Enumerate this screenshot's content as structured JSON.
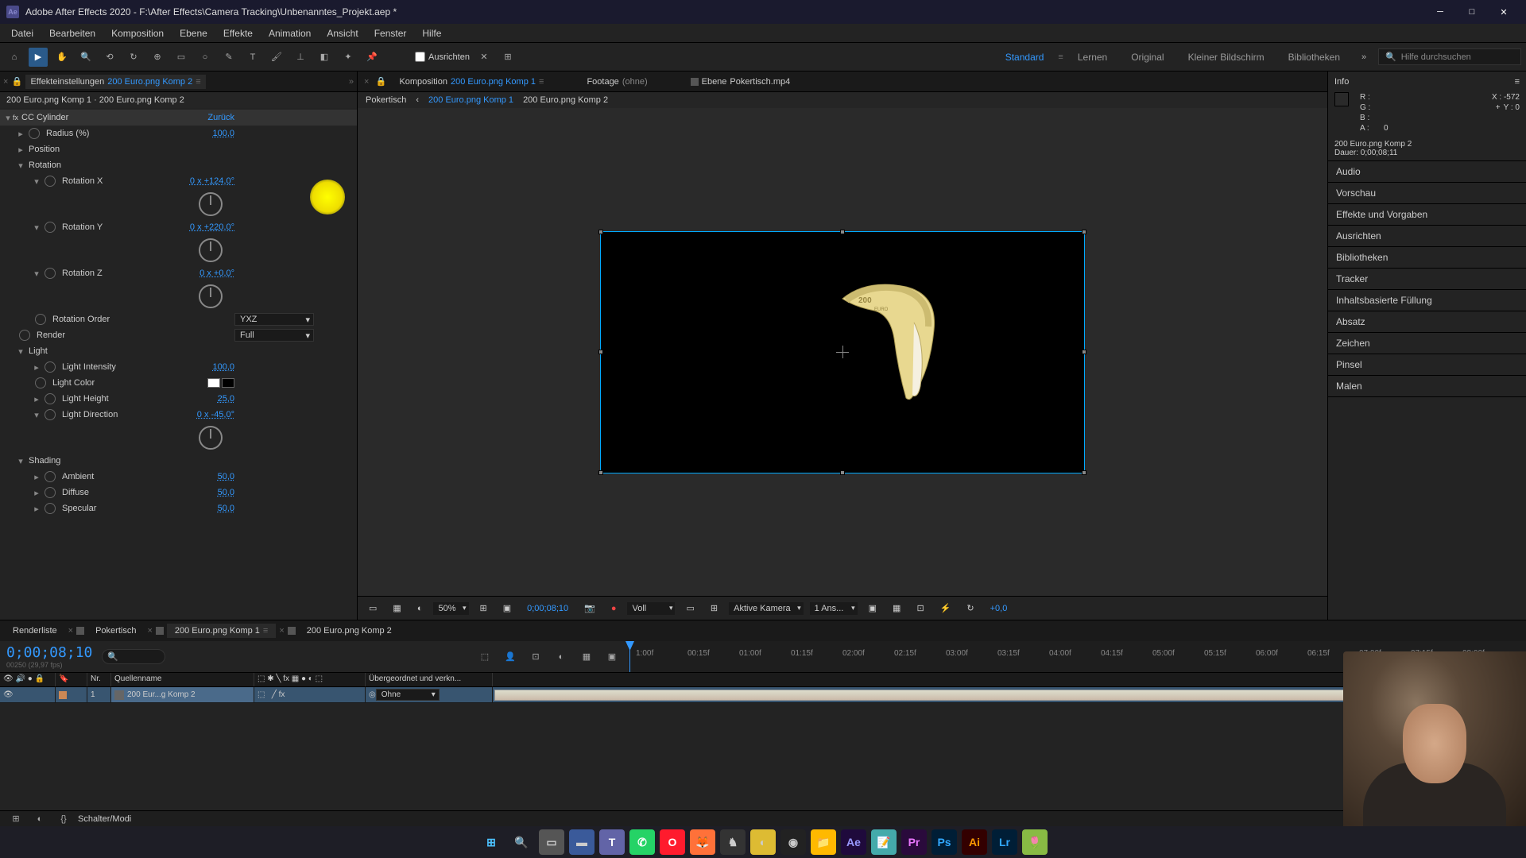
{
  "app": {
    "title": "Adobe After Effects 2020 - F:\\After Effects\\Camera Tracking\\Unbenanntes_Projekt.aep *"
  },
  "menu": {
    "items": [
      "Datei",
      "Bearbeiten",
      "Komposition",
      "Ebene",
      "Effekte",
      "Animation",
      "Ansicht",
      "Fenster",
      "Hilfe"
    ]
  },
  "toolbar": {
    "ausrichten": "Ausrichten",
    "workspaces": [
      "Standard",
      "Lernen",
      "Original",
      "Kleiner Bildschirm",
      "Bibliotheken"
    ],
    "active_workspace": "Standard",
    "search_placeholder": "Hilfe durchsuchen"
  },
  "effects_panel": {
    "tab_label": "Effekteinstellungen",
    "tab_comp": "200 Euro.png Komp 2",
    "breadcrumb": "200 Euro.png Komp 1 · 200 Euro.png Komp 2",
    "effect_name": "CC Cylinder",
    "reset": "Zurück",
    "props": {
      "radius": {
        "name": "Radius (%)",
        "value": "100,0"
      },
      "position": {
        "name": "Position"
      },
      "rotation": {
        "name": "Rotation"
      },
      "rotx": {
        "name": "Rotation X",
        "value": "0 x +124,0°"
      },
      "roty": {
        "name": "Rotation Y",
        "value": "0 x +220,0°"
      },
      "rotz": {
        "name": "Rotation Z",
        "value": "0 x +0,0°"
      },
      "rot_order": {
        "name": "Rotation Order",
        "value": "YXZ"
      },
      "render": {
        "name": "Render",
        "value": "Full"
      },
      "light": {
        "name": "Light"
      },
      "light_intensity": {
        "name": "Light Intensity",
        "value": "100,0"
      },
      "light_color": {
        "name": "Light Color"
      },
      "light_height": {
        "name": "Light Height",
        "value": "25,0"
      },
      "light_direction": {
        "name": "Light Direction",
        "value": "0 x -45,0°"
      },
      "shading": {
        "name": "Shading"
      },
      "ambient": {
        "name": "Ambient",
        "value": "50,0"
      },
      "diffuse": {
        "name": "Diffuse",
        "value": "50,0"
      },
      "specular": {
        "name": "Specular",
        "value": "50,0"
      }
    }
  },
  "viewer": {
    "tabs": {
      "komp": {
        "label": "Komposition",
        "comp": "200 Euro.png Komp 1"
      },
      "footage": {
        "label": "Footage",
        "value": "(ohne)"
      },
      "ebene": {
        "label": "Ebene",
        "value": "Pokertisch.mp4"
      }
    },
    "breadcrumb": [
      "Pokertisch",
      "200 Euro.png Komp 1",
      "200 Euro.png Komp 2"
    ],
    "active_bc": "200 Euro.png Komp 1",
    "controls": {
      "zoom": "50%",
      "timecode": "0;00;08;10",
      "quality": "Voll",
      "camera": "Aktive Kamera",
      "views": "1 Ans...",
      "exposure": "+0,0"
    }
  },
  "info": {
    "title": "Info",
    "r": "R :",
    "g": "G :",
    "b": "B :",
    "a": "A :",
    "a_val": "0",
    "x": "X : -572",
    "y": "Y : 0",
    "layer_name": "200 Euro.png Komp 2",
    "duration_label": "Dauer:",
    "duration": "0;00;08;11"
  },
  "right_panels": [
    "Audio",
    "Vorschau",
    "Effekte und Vorgaben",
    "Ausrichten",
    "Bibliotheken",
    "Tracker",
    "Inhaltsbasierte Füllung",
    "Absatz",
    "Zeichen",
    "Pinsel",
    "Malen"
  ],
  "timeline": {
    "tabs": [
      "Renderliste",
      "Pokertisch",
      "200 Euro.png Komp 1",
      "200 Euro.png Komp 2"
    ],
    "active_tab": "200 Euro.png Komp 1",
    "timecode": "0;00;08;10",
    "frame_info": "00250 (29,97 fps)",
    "ticks": [
      "1:00f",
      "00:15f",
      "01:00f",
      "01:15f",
      "02:00f",
      "02:15f",
      "03:00f",
      "03:15f",
      "04:00f",
      "04:15f",
      "05:00f",
      "05:15f",
      "06:00f",
      "06:15f",
      "07:00f",
      "07:15f",
      "08:00f"
    ],
    "columns": {
      "nr": "Nr.",
      "quellenname": "Quellenname",
      "ubergeordnet": "Übergeordnet und verkn..."
    },
    "layer": {
      "nr": "1",
      "name": "200 Eur...g Komp 2",
      "parent": "Ohne"
    },
    "footer": "Schalter/Modi"
  }
}
